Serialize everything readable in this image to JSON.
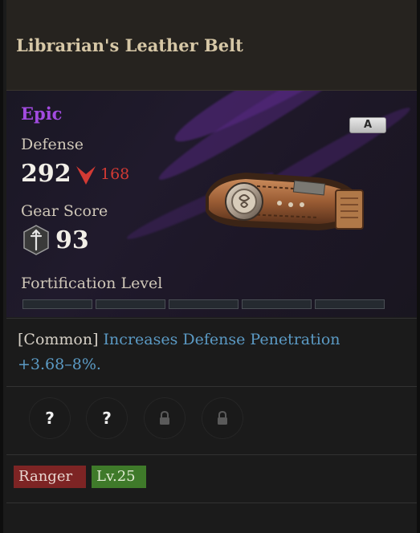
{
  "item": {
    "name": "Librarian's Leather Belt",
    "grade": "Epic",
    "badge": "A"
  },
  "stats": {
    "defense_label": "Defense",
    "defense_value": "292",
    "defense_diff": "168",
    "gear_score_label": "Gear Score",
    "gear_score_value": "93"
  },
  "fortification": {
    "label": "Fortification Level",
    "filled_segments": 0,
    "total_segments": 5
  },
  "effect": {
    "rarity_tag": "[Common]",
    "text": " Increases Defense Penetration +3.68–8%."
  },
  "sockets": [
    {
      "icon": "question-mark-icon",
      "state": "unknown"
    },
    {
      "icon": "question-mark-icon",
      "state": "unknown"
    },
    {
      "icon": "lock-icon",
      "state": "locked"
    },
    {
      "icon": "lock-icon",
      "state": "locked"
    }
  ],
  "tags": {
    "class": "Ranger",
    "level": "Lv.25"
  },
  "colors": {
    "title": "#d6c7a6",
    "grade_epic": "#a24be0",
    "defense_decrease": "#d23a34",
    "effect_text": "#5b9ac4",
    "class_tag": "#7d2424",
    "level_tag": "#3f7a2a"
  }
}
